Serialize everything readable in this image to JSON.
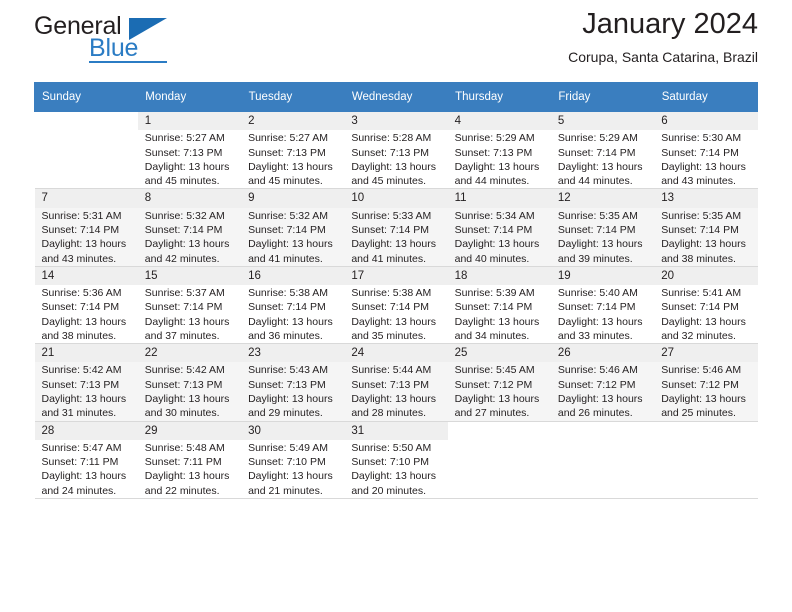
{
  "logo": {
    "word1": "General",
    "word2": "Blue",
    "triangle_color": "#1b6cb3",
    "blue_color": "#2b7cc4"
  },
  "header": {
    "title": "January 2024",
    "subtitle": "Corupa, Santa Catarina, Brazil"
  },
  "theme": {
    "header_row_bg": "#3a7ebf",
    "header_row_text": "#ffffff",
    "alt_row_bg": "#f5f5f5",
    "grid_line": "#d9d9d9",
    "text": "#231f20"
  },
  "calendar": {
    "weekday_headers": [
      "Sunday",
      "Monday",
      "Tuesday",
      "Wednesday",
      "Thursday",
      "Friday",
      "Saturday"
    ],
    "weeks": [
      {
        "alt": false,
        "days": [
          {
            "num": "",
            "lines": []
          },
          {
            "num": "1",
            "lines": [
              "Sunrise: 5:27 AM",
              "Sunset: 7:13 PM",
              "Daylight: 13 hours",
              "and 45 minutes."
            ]
          },
          {
            "num": "2",
            "lines": [
              "Sunrise: 5:27 AM",
              "Sunset: 7:13 PM",
              "Daylight: 13 hours",
              "and 45 minutes."
            ]
          },
          {
            "num": "3",
            "lines": [
              "Sunrise: 5:28 AM",
              "Sunset: 7:13 PM",
              "Daylight: 13 hours",
              "and 45 minutes."
            ]
          },
          {
            "num": "4",
            "lines": [
              "Sunrise: 5:29 AM",
              "Sunset: 7:13 PM",
              "Daylight: 13 hours",
              "and 44 minutes."
            ]
          },
          {
            "num": "5",
            "lines": [
              "Sunrise: 5:29 AM",
              "Sunset: 7:14 PM",
              "Daylight: 13 hours",
              "and 44 minutes."
            ]
          },
          {
            "num": "6",
            "lines": [
              "Sunrise: 5:30 AM",
              "Sunset: 7:14 PM",
              "Daylight: 13 hours",
              "and 43 minutes."
            ]
          }
        ]
      },
      {
        "alt": true,
        "days": [
          {
            "num": "7",
            "lines": [
              "Sunrise: 5:31 AM",
              "Sunset: 7:14 PM",
              "Daylight: 13 hours",
              "and 43 minutes."
            ]
          },
          {
            "num": "8",
            "lines": [
              "Sunrise: 5:32 AM",
              "Sunset: 7:14 PM",
              "Daylight: 13 hours",
              "and 42 minutes."
            ]
          },
          {
            "num": "9",
            "lines": [
              "Sunrise: 5:32 AM",
              "Sunset: 7:14 PM",
              "Daylight: 13 hours",
              "and 41 minutes."
            ]
          },
          {
            "num": "10",
            "lines": [
              "Sunrise: 5:33 AM",
              "Sunset: 7:14 PM",
              "Daylight: 13 hours",
              "and 41 minutes."
            ]
          },
          {
            "num": "11",
            "lines": [
              "Sunrise: 5:34 AM",
              "Sunset: 7:14 PM",
              "Daylight: 13 hours",
              "and 40 minutes."
            ]
          },
          {
            "num": "12",
            "lines": [
              "Sunrise: 5:35 AM",
              "Sunset: 7:14 PM",
              "Daylight: 13 hours",
              "and 39 minutes."
            ]
          },
          {
            "num": "13",
            "lines": [
              "Sunrise: 5:35 AM",
              "Sunset: 7:14 PM",
              "Daylight: 13 hours",
              "and 38 minutes."
            ]
          }
        ]
      },
      {
        "alt": false,
        "days": [
          {
            "num": "14",
            "lines": [
              "Sunrise: 5:36 AM",
              "Sunset: 7:14 PM",
              "Daylight: 13 hours",
              "and 38 minutes."
            ]
          },
          {
            "num": "15",
            "lines": [
              "Sunrise: 5:37 AM",
              "Sunset: 7:14 PM",
              "Daylight: 13 hours",
              "and 37 minutes."
            ]
          },
          {
            "num": "16",
            "lines": [
              "Sunrise: 5:38 AM",
              "Sunset: 7:14 PM",
              "Daylight: 13 hours",
              "and 36 minutes."
            ]
          },
          {
            "num": "17",
            "lines": [
              "Sunrise: 5:38 AM",
              "Sunset: 7:14 PM",
              "Daylight: 13 hours",
              "and 35 minutes."
            ]
          },
          {
            "num": "18",
            "lines": [
              "Sunrise: 5:39 AM",
              "Sunset: 7:14 PM",
              "Daylight: 13 hours",
              "and 34 minutes."
            ]
          },
          {
            "num": "19",
            "lines": [
              "Sunrise: 5:40 AM",
              "Sunset: 7:14 PM",
              "Daylight: 13 hours",
              "and 33 minutes."
            ]
          },
          {
            "num": "20",
            "lines": [
              "Sunrise: 5:41 AM",
              "Sunset: 7:14 PM",
              "Daylight: 13 hours",
              "and 32 minutes."
            ]
          }
        ]
      },
      {
        "alt": true,
        "days": [
          {
            "num": "21",
            "lines": [
              "Sunrise: 5:42 AM",
              "Sunset: 7:13 PM",
              "Daylight: 13 hours",
              "and 31 minutes."
            ]
          },
          {
            "num": "22",
            "lines": [
              "Sunrise: 5:42 AM",
              "Sunset: 7:13 PM",
              "Daylight: 13 hours",
              "and 30 minutes."
            ]
          },
          {
            "num": "23",
            "lines": [
              "Sunrise: 5:43 AM",
              "Sunset: 7:13 PM",
              "Daylight: 13 hours",
              "and 29 minutes."
            ]
          },
          {
            "num": "24",
            "lines": [
              "Sunrise: 5:44 AM",
              "Sunset: 7:13 PM",
              "Daylight: 13 hours",
              "and 28 minutes."
            ]
          },
          {
            "num": "25",
            "lines": [
              "Sunrise: 5:45 AM",
              "Sunset: 7:12 PM",
              "Daylight: 13 hours",
              "and 27 minutes."
            ]
          },
          {
            "num": "26",
            "lines": [
              "Sunrise: 5:46 AM",
              "Sunset: 7:12 PM",
              "Daylight: 13 hours",
              "and 26 minutes."
            ]
          },
          {
            "num": "27",
            "lines": [
              "Sunrise: 5:46 AM",
              "Sunset: 7:12 PM",
              "Daylight: 13 hours",
              "and 25 minutes."
            ]
          }
        ]
      },
      {
        "alt": false,
        "days": [
          {
            "num": "28",
            "lines": [
              "Sunrise: 5:47 AM",
              "Sunset: 7:11 PM",
              "Daylight: 13 hours",
              "and 24 minutes."
            ]
          },
          {
            "num": "29",
            "lines": [
              "Sunrise: 5:48 AM",
              "Sunset: 7:11 PM",
              "Daylight: 13 hours",
              "and 22 minutes."
            ]
          },
          {
            "num": "30",
            "lines": [
              "Sunrise: 5:49 AM",
              "Sunset: 7:10 PM",
              "Daylight: 13 hours",
              "and 21 minutes."
            ]
          },
          {
            "num": "31",
            "lines": [
              "Sunrise: 5:50 AM",
              "Sunset: 7:10 PM",
              "Daylight: 13 hours",
              "and 20 minutes."
            ]
          },
          {
            "num": "",
            "lines": []
          },
          {
            "num": "",
            "lines": []
          },
          {
            "num": "",
            "lines": []
          }
        ]
      }
    ]
  }
}
